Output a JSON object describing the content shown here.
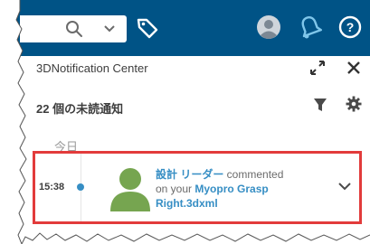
{
  "header": {
    "search": {
      "value": "",
      "placeholder": ""
    }
  },
  "notifications": {
    "title": "3DNotification Center",
    "unread_summary": "22 個の未読通知",
    "group_label": "今日",
    "items": [
      {
        "time": "15:38",
        "author": "設計 リーダー",
        "action": " commented",
        "preposition": "on your ",
        "target": "Myopro Grasp Right.3dxml"
      }
    ]
  },
  "colors": {
    "topbar": "#005386",
    "accent": "#368ec4",
    "highlight_border": "#e23b3b",
    "avatar": "#76a550"
  }
}
